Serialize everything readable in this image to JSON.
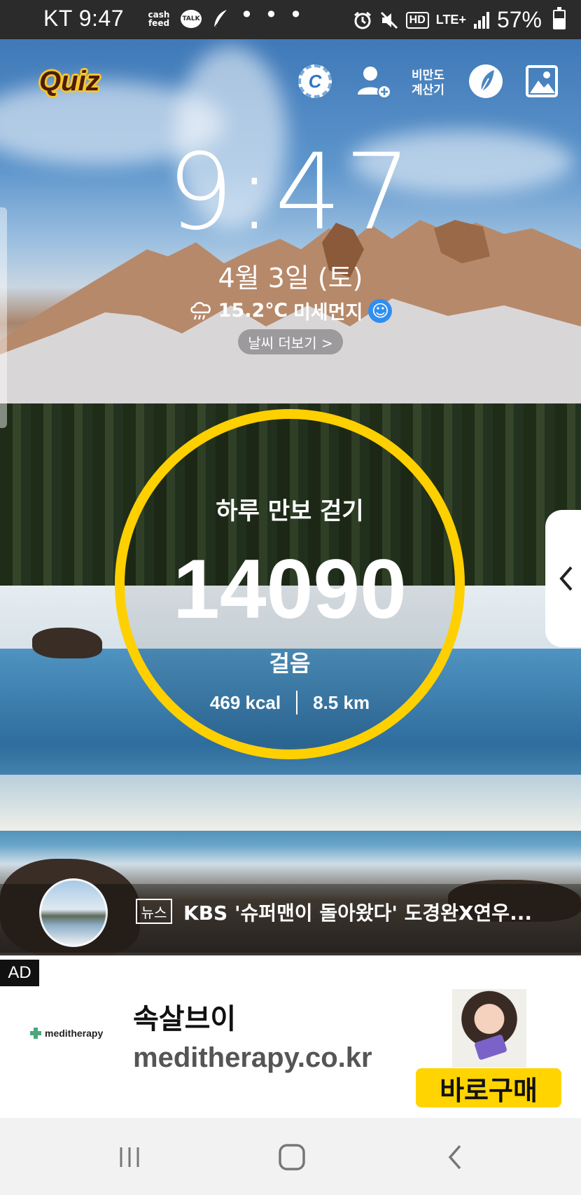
{
  "status_bar": {
    "carrier_time": "KT 9:47",
    "cash_feed_line1": "cash",
    "cash_feed_line2": "feed",
    "talk_label": "TALK",
    "overflow_dots": "• • •",
    "hd_label": "HD",
    "lte_label": "LTE+",
    "battery_percent": "57%",
    "battery_level": 0.57
  },
  "top_bar": {
    "quiz_label": "Quiz",
    "coin_label": "C",
    "bmi_line1": "비만도",
    "bmi_line2": "계산기"
  },
  "lockscreen": {
    "time": "9:47",
    "date": "4월 3일 (토)",
    "temperature": "15.2℃",
    "dust_label": "미세먼지",
    "dust_face": "☺",
    "more_weather": "날씨 더보기 >"
  },
  "pedometer": {
    "title": "하루 만보 걷기",
    "steps": "14090",
    "unit": "걸음",
    "kcal": "469 kcal",
    "distance": "8.5 km",
    "ring_color": "#ffd000"
  },
  "news": {
    "badge": "뉴스",
    "headline": "KBS '슈퍼맨이 돌아왔다' 도경완X연우..."
  },
  "ad": {
    "label": "AD",
    "logo_text": "meditherapy",
    "title": "속살브이",
    "url": "meditherapy.co.kr",
    "cta": "바로구매",
    "cta_color": "#ffd400"
  },
  "nav": {
    "recents_icon": "recents-icon",
    "home_icon": "home-icon",
    "back_icon": "back-icon"
  }
}
